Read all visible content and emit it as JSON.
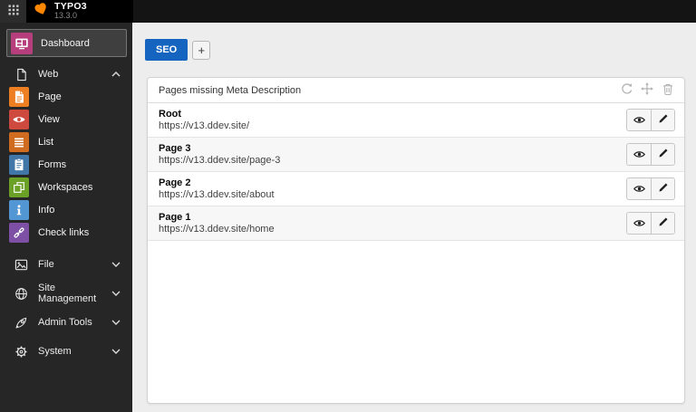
{
  "topbar": {
    "product": "TYPO3",
    "version": "13.3.0",
    "brand_color": "#ff8700",
    "modules_icon": "grid-icon"
  },
  "sidebar": {
    "active_item": {
      "label": "Dashboard",
      "icon": "dashboard-icon",
      "icon_color": "#b63e7c"
    },
    "sections": [
      {
        "label": "Web",
        "icon": "document-icon",
        "state": "expanded",
        "items": [
          {
            "label": "Page",
            "icon": "page-icon",
            "icon_color": "#ee7e22"
          },
          {
            "label": "View",
            "icon": "view-eye-icon",
            "icon_color": "#ce4a3f"
          },
          {
            "label": "List",
            "icon": "list-icon",
            "icon_color": "#cf6c1f"
          },
          {
            "label": "Forms",
            "icon": "clipboard-icon",
            "icon_color": "#4076a8"
          },
          {
            "label": "Workspaces",
            "icon": "layers-icon",
            "icon_color": "#6ba127"
          },
          {
            "label": "Info",
            "icon": "info-icon",
            "icon_color": "#5296d3"
          },
          {
            "label": "Check links",
            "icon": "chain-link-icon",
            "icon_color": "#7d50a5"
          }
        ]
      },
      {
        "label": "File",
        "icon": "image-icon",
        "state": "collapsed",
        "items": []
      },
      {
        "label": "Site Management",
        "icon": "globe-icon",
        "state": "collapsed",
        "items": []
      },
      {
        "label": "Admin Tools",
        "icon": "rocket-icon",
        "state": "collapsed",
        "items": []
      },
      {
        "label": "System",
        "icon": "gear-icon",
        "state": "collapsed",
        "items": []
      }
    ]
  },
  "main": {
    "tabs": [
      {
        "label": "SEO",
        "active": true
      }
    ],
    "add_tab_label": "+",
    "widget": {
      "title": "Pages missing Meta Description",
      "actions": [
        "refresh",
        "move",
        "delete"
      ],
      "row_actions": [
        "view",
        "edit"
      ],
      "rows": [
        {
          "title": "Root",
          "url": "https://v13.ddev.site/"
        },
        {
          "title": "Page 3",
          "url": "https://v13.ddev.site/page-3"
        },
        {
          "title": "Page 2",
          "url": "https://v13.ddev.site/about"
        },
        {
          "title": "Page 1",
          "url": "https://v13.ddev.site/home"
        }
      ]
    }
  },
  "colors": {
    "accent_blue": "#1565c0",
    "topbar_bg": "#141414",
    "sidebar_bg": "#262626",
    "content_bg": "#ededed"
  }
}
